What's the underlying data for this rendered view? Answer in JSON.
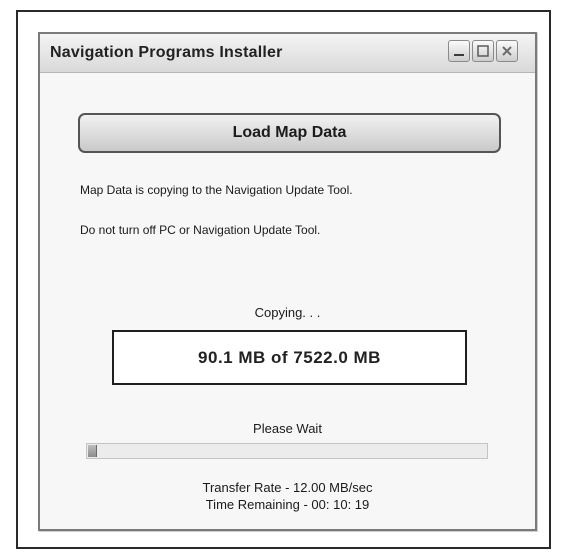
{
  "window": {
    "title": "Navigation Programs Installer"
  },
  "controls": {
    "minimize_icon": "minimize-icon",
    "maximize_icon": "maximize-icon",
    "close_icon": "close-icon"
  },
  "main": {
    "load_button_label": "Load Map Data",
    "message_line_1": "Map Data is copying to the Navigation Update Tool.",
    "message_line_2": "Do not turn off PC or Navigation Update Tool.",
    "copying_label": "Copying. . .",
    "size_text": "90.1 MB of 7522.0 MB",
    "wait_label": "Please Wait",
    "progress_fraction": 0.012,
    "transfer_rate": "Transfer Rate - 12.00 MB/sec",
    "time_remaining": "Time Remaining - 00: 10: 19"
  },
  "colors": {
    "window_background": "#f7f7f7",
    "button_gradient_top": "#f2f2f2",
    "button_gradient_bottom": "#c9c9c9",
    "progress_fill": "#8d8d8d"
  }
}
